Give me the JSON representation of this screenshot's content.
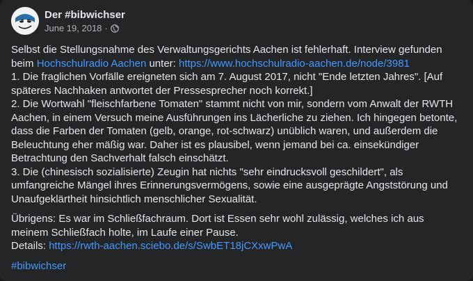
{
  "post": {
    "author": "Der #bibwichser",
    "date": "June 19, 2018",
    "separator": "·",
    "privacy_icon": "globe-icon",
    "intro_prefix": "Selbst die Stellungsnahme des Verwaltungsgerichts Aachen ist fehlerhaft. Interview gefunden beim ",
    "intro_link_text": "Hochschulradio Aachen",
    "intro_middle": " unter: ",
    "intro_url": "https://www.hochschulradio-aachen.de/node/3981",
    "point1": "1. Die fraglichen Vorfälle ereigneten sich am 7. August 2017, nicht \"Ende letzten Jahres\". [Auf späteres Nachhaken antwortet der Pressesprecher noch korrekt.]",
    "point2": "2. Die Wortwahl \"fleischfarbene Tomaten\" stammt nicht von mir, sondern vom Anwalt der RWTH Aachen, in einem Versuch meine Ausführungen ins Lächerliche zu ziehen. Ich hingegen betonte, dass die Farben der Tomaten (gelb, orange, rot-schwarz) unüblich waren, und außerdem die Beleuchtung eher mäßig war. Daher ist es plausibel, wenn jemand bei ca. einsekündiger Betrachtung den Sachverhalt falsch einschätzt.",
    "point3": "3. Die (chinesisch sozialisierte) Zeugin hat nichts \"sehr eindrucksvoll geschildert\", als umfangreiche Mängel ihres Erinnerungsvermögens, sowie eine ausgeprägte Angststörung und Unaufgeklärtheit hinsichtlich menschlicher Sexualität.",
    "uebrigens": "Übrigens: Es war im Schließfachraum. Dort ist Essen sehr wohl zulässig, welches ich aus meinem Schließfach holte, im Laufe einer Pause.",
    "details_label": "Details: ",
    "details_url": "https://rwth-aachen.sciebo.de/s/SwbET18jCXxwPwA",
    "hashtag": "#bibwichser"
  },
  "colors": {
    "card_bg": "#242526",
    "text": "#e4e6eb",
    "secondary_text": "#b0b3b8",
    "link": "#4599ff"
  }
}
